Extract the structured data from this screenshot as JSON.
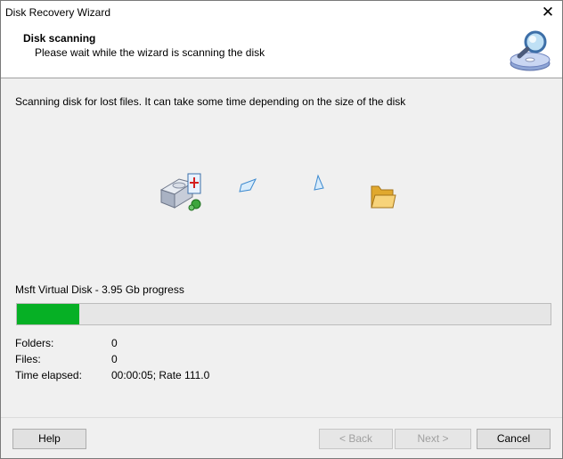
{
  "window": {
    "title": "Disk Recovery Wizard",
    "close_glyph": "✕"
  },
  "header": {
    "title": "Disk scanning",
    "subtitle": "Please wait while the wizard is scanning the disk",
    "icon": "disk-search-icon"
  },
  "content": {
    "description": "Scanning disk for lost files. It can take some time depending on the size of the disk",
    "disk_label": "Msft Virtual Disk - 3.95 Gb progress",
    "progress_fraction": 0.117,
    "progress_color": "#06b025",
    "stats": [
      {
        "label": "Folders:",
        "value": "0"
      },
      {
        "label": "Files:",
        "value": "0"
      },
      {
        "label": "Time elapsed:",
        "value": "00:00:05; Rate 111.0"
      }
    ]
  },
  "buttons": {
    "help": "Help",
    "back": "< Back",
    "next": "Next >",
    "cancel": "Cancel"
  }
}
